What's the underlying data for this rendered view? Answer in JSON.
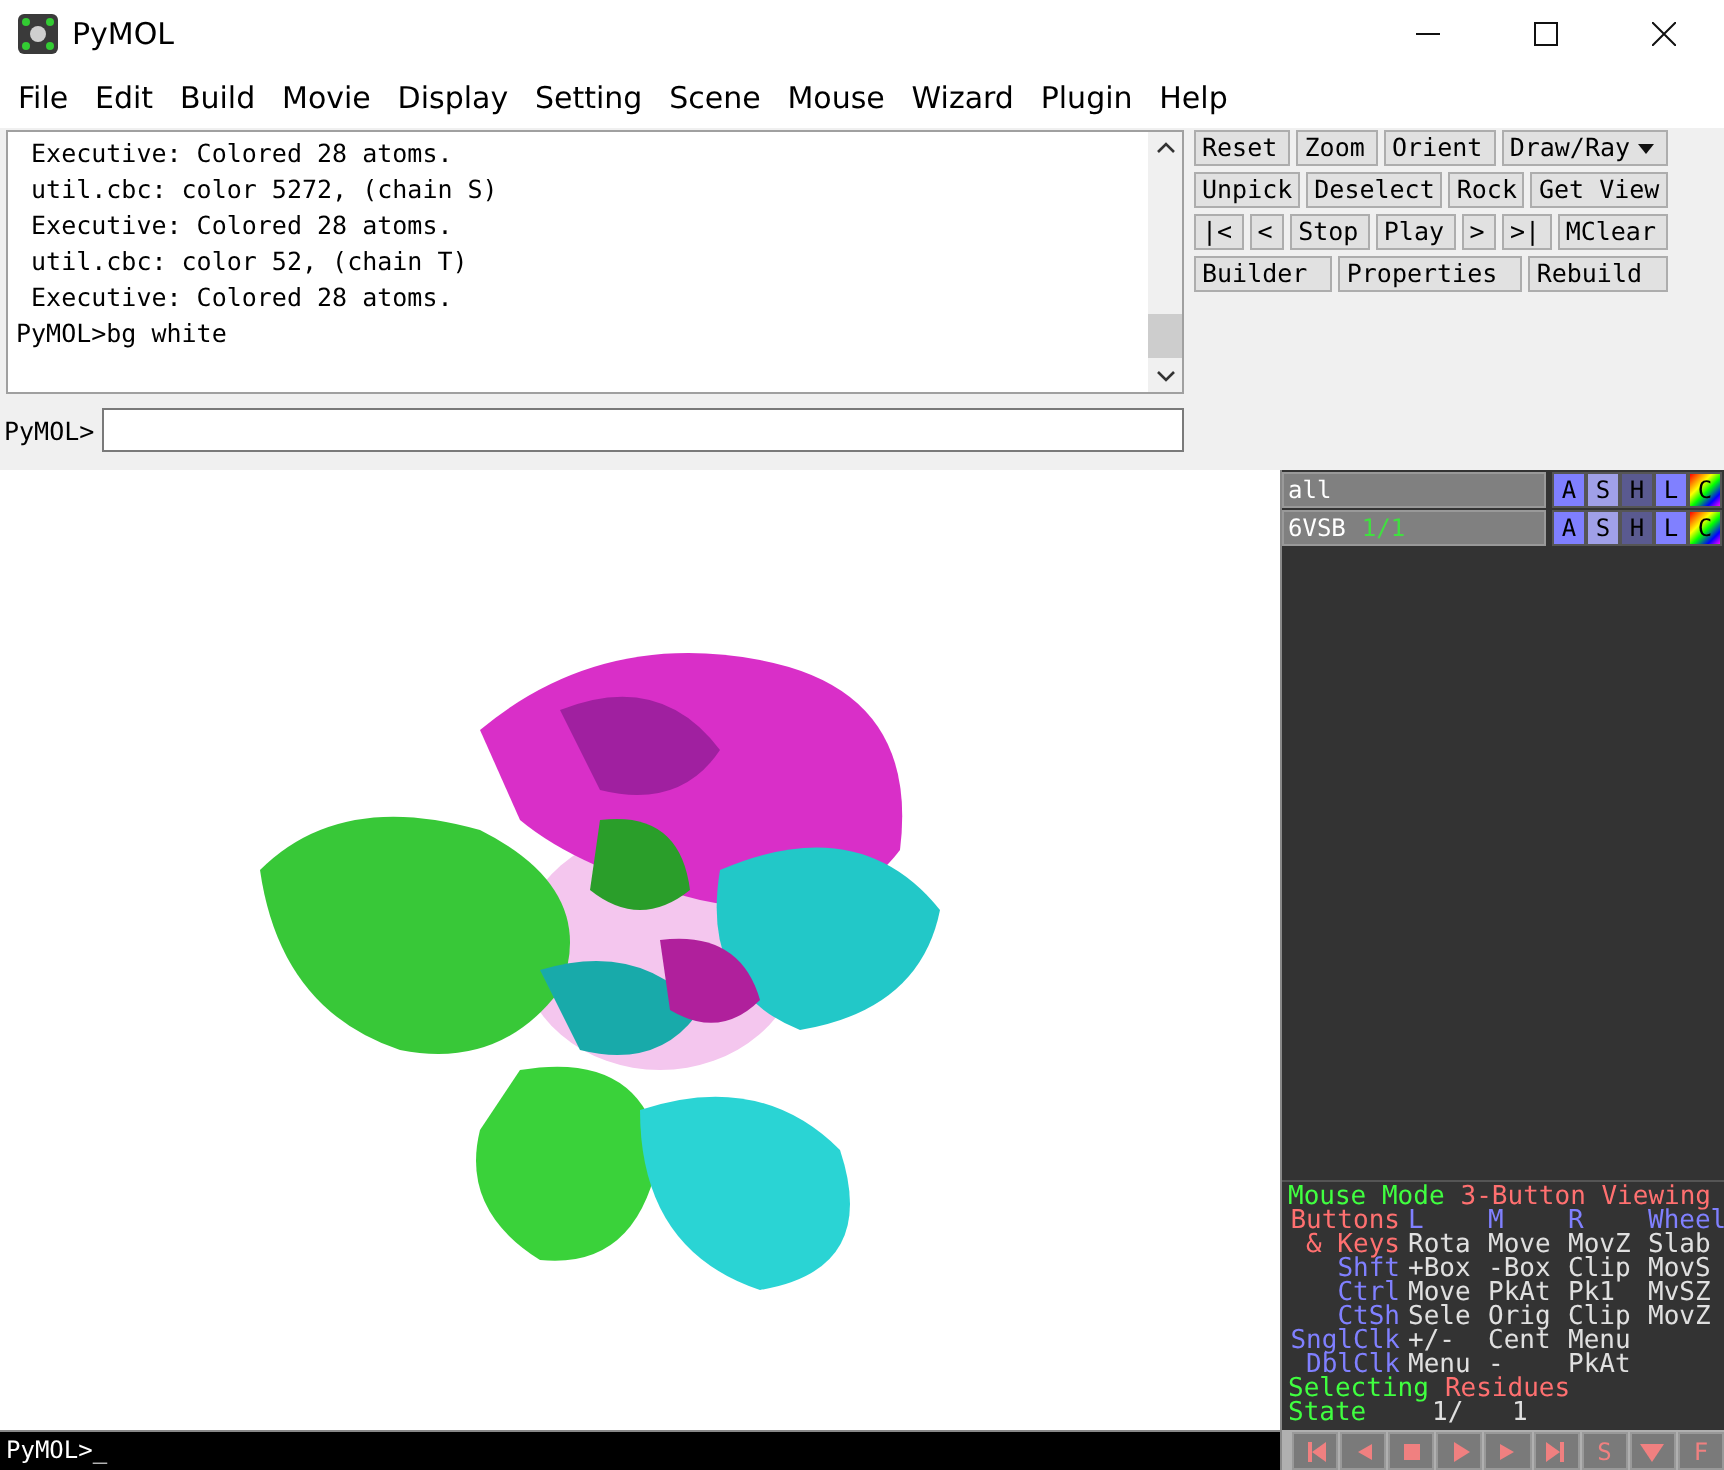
{
  "window": {
    "title": "PyMOL"
  },
  "menu": [
    "File",
    "Edit",
    "Build",
    "Movie",
    "Display",
    "Setting",
    "Scene",
    "Mouse",
    "Wizard",
    "Plugin",
    "Help"
  ],
  "log": {
    "lines": [
      " Executive: Colored 28 atoms.",
      " util.cbc: color 5272, (chain S)",
      " Executive: Colored 28 atoms.",
      " util.cbc: color 52, (chain T)",
      " Executive: Colored 28 atoms.",
      "PyMOL>bg white"
    ]
  },
  "command": {
    "prompt": "PyMOL>"
  },
  "buttons": [
    [
      {
        "label": "Reset",
        "kind": "plain"
      },
      {
        "label": "Zoom",
        "kind": "plain"
      },
      {
        "label": "Orient",
        "kind": "plain"
      },
      {
        "label": "Draw/Ray",
        "kind": "dropdown"
      }
    ],
    [
      {
        "label": "Unpick",
        "kind": "plain"
      },
      {
        "label": "Deselect",
        "kind": "plain"
      },
      {
        "label": "Rock",
        "kind": "plain"
      },
      {
        "label": "Get View",
        "kind": "plain"
      }
    ],
    [
      {
        "label": "|<",
        "kind": "plain"
      },
      {
        "label": "<",
        "kind": "plain"
      },
      {
        "label": "Stop",
        "kind": "plain"
      },
      {
        "label": "Play",
        "kind": "plain"
      },
      {
        "label": ">",
        "kind": "plain"
      },
      {
        "label": ">|",
        "kind": "plain"
      },
      {
        "label": "MClear",
        "kind": "plain"
      }
    ],
    [
      {
        "label": "Builder",
        "kind": "plain"
      },
      {
        "label": "Properties",
        "kind": "plain"
      },
      {
        "label": "Rebuild",
        "kind": "plain"
      }
    ]
  ],
  "objects": [
    {
      "name": "all",
      "buttons": [
        "A",
        "S",
        "H",
        "L",
        "C"
      ]
    },
    {
      "name": "6VSB",
      "state": "1/1",
      "buttons": [
        "A",
        "S",
        "H",
        "L",
        "C"
      ]
    }
  ],
  "mouse_panel": {
    "rows": [
      {
        "kind": "line",
        "cells": [
          {
            "text": "Mouse Mode",
            "color": "#40ff40"
          },
          {
            "text": "3-Button Viewing",
            "color": "#ff7070"
          }
        ]
      },
      {
        "kind": "grid",
        "cells": [
          {
            "text": "Buttons",
            "color": "#ff7070"
          },
          {
            "text": "L",
            "color": "#8080ff"
          },
          {
            "text": "M",
            "color": "#8080ff"
          },
          {
            "text": "R",
            "color": "#8080ff"
          },
          {
            "text": "Wheel",
            "color": "#8080ff"
          }
        ]
      },
      {
        "kind": "grid",
        "cells": [
          {
            "text": "& Keys",
            "color": "#ff7070"
          },
          {
            "text": "Rota",
            "color": "#e0e0e0"
          },
          {
            "text": "Move",
            "color": "#e0e0e0"
          },
          {
            "text": "MovZ",
            "color": "#e0e0e0"
          },
          {
            "text": "Slab",
            "color": "#e0e0e0"
          }
        ]
      },
      {
        "kind": "grid",
        "cells": [
          {
            "text": "Shft",
            "color": "#8080ff"
          },
          {
            "text": "+Box",
            "color": "#e0e0e0"
          },
          {
            "text": "-Box",
            "color": "#e0e0e0"
          },
          {
            "text": "Clip",
            "color": "#e0e0e0"
          },
          {
            "text": "MovS",
            "color": "#e0e0e0"
          }
        ]
      },
      {
        "kind": "grid",
        "cells": [
          {
            "text": "Ctrl",
            "color": "#8080ff"
          },
          {
            "text": "Move",
            "color": "#e0e0e0"
          },
          {
            "text": "PkAt",
            "color": "#e0e0e0"
          },
          {
            "text": "Pk1",
            "color": "#e0e0e0"
          },
          {
            "text": "MvSZ",
            "color": "#e0e0e0"
          }
        ]
      },
      {
        "kind": "grid",
        "cells": [
          {
            "text": "CtSh",
            "color": "#8080ff"
          },
          {
            "text": "Sele",
            "color": "#e0e0e0"
          },
          {
            "text": "Orig",
            "color": "#e0e0e0"
          },
          {
            "text": "Clip",
            "color": "#e0e0e0"
          },
          {
            "text": "MovZ",
            "color": "#e0e0e0"
          }
        ]
      },
      {
        "kind": "grid",
        "cells": [
          {
            "text": "SnglClk",
            "color": "#8080ff"
          },
          {
            "text": "+/-",
            "color": "#e0e0e0"
          },
          {
            "text": "Cent",
            "color": "#e0e0e0"
          },
          {
            "text": "Menu",
            "color": "#e0e0e0"
          }
        ]
      },
      {
        "kind": "grid",
        "cells": [
          {
            "text": "DblClk",
            "color": "#8080ff"
          },
          {
            "text": "Menu",
            "color": "#e0e0e0"
          },
          {
            "text": "-",
            "color": "#e0e0e0"
          },
          {
            "text": "PkAt",
            "color": "#e0e0e0"
          }
        ]
      },
      {
        "kind": "line",
        "cells": [
          {
            "text": "Selecting",
            "color": "#40ff40"
          },
          {
            "text": "Residues",
            "color": "#ff7070"
          }
        ]
      },
      {
        "kind": "state",
        "cells": [
          {
            "text": "State",
            "color": "#40ff40"
          },
          {
            "text": "1/",
            "color": "#e0e0e0"
          },
          {
            "text": "1",
            "color": "#e0e0e0"
          }
        ]
      }
    ]
  },
  "playback": [
    {
      "kind": "first"
    },
    {
      "kind": "prev"
    },
    {
      "kind": "stop"
    },
    {
      "kind": "play"
    },
    {
      "kind": "next"
    },
    {
      "kind": "last"
    },
    {
      "kind": "text",
      "label": "S"
    },
    {
      "kind": "down"
    },
    {
      "kind": "text",
      "label": "F"
    }
  ],
  "console": {
    "text": "PyMOL>_"
  }
}
